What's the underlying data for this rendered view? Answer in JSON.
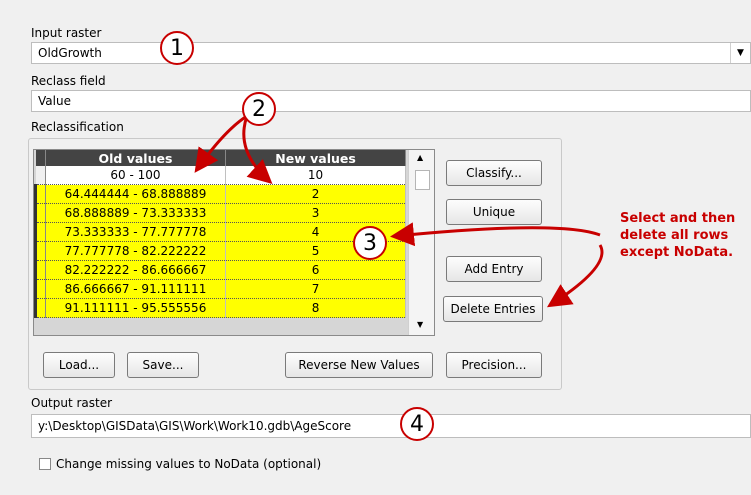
{
  "input_raster": {
    "label": "Input raster",
    "value": "OldGrowth"
  },
  "reclass_field": {
    "label": "Reclass field",
    "value": "Value"
  },
  "reclassification": {
    "label": "Reclassification",
    "columns": [
      "Old values",
      "New values"
    ],
    "rows": [
      {
        "old": "60 - 100",
        "new": "10"
      },
      {
        "old": "64.444444 - 68.888889",
        "new": "2"
      },
      {
        "old": "68.888889 - 73.333333",
        "new": "3"
      },
      {
        "old": "73.333333 - 77.777778",
        "new": "4"
      },
      {
        "old": "77.777778 - 82.222222",
        "new": "5"
      },
      {
        "old": "82.222222 - 86.666667",
        "new": "6"
      },
      {
        "old": "86.666667 - 91.111111",
        "new": "7"
      },
      {
        "old": "91.111111 - 95.555556",
        "new": "8"
      }
    ],
    "highlight_color": "#ffff00"
  },
  "buttons": {
    "classify": "Classify...",
    "unique": "Unique",
    "add_entry": "Add Entry",
    "delete_entries": "Delete Entries",
    "load": "Load...",
    "save": "Save...",
    "reverse": "Reverse New Values",
    "precision": "Precision..."
  },
  "output_raster": {
    "label": "Output raster",
    "value": "y:\\Desktop\\GISData\\GIS\\Work\\Work10.gdb\\AgeScore"
  },
  "change_missing": {
    "label": "Change missing values to NoData (optional)",
    "checked": false
  },
  "annotations": {
    "callouts": [
      "1",
      "2",
      "3",
      "4"
    ],
    "note": [
      "Select and then",
      "delete all rows",
      "except NoData."
    ],
    "color": "#c80000"
  }
}
